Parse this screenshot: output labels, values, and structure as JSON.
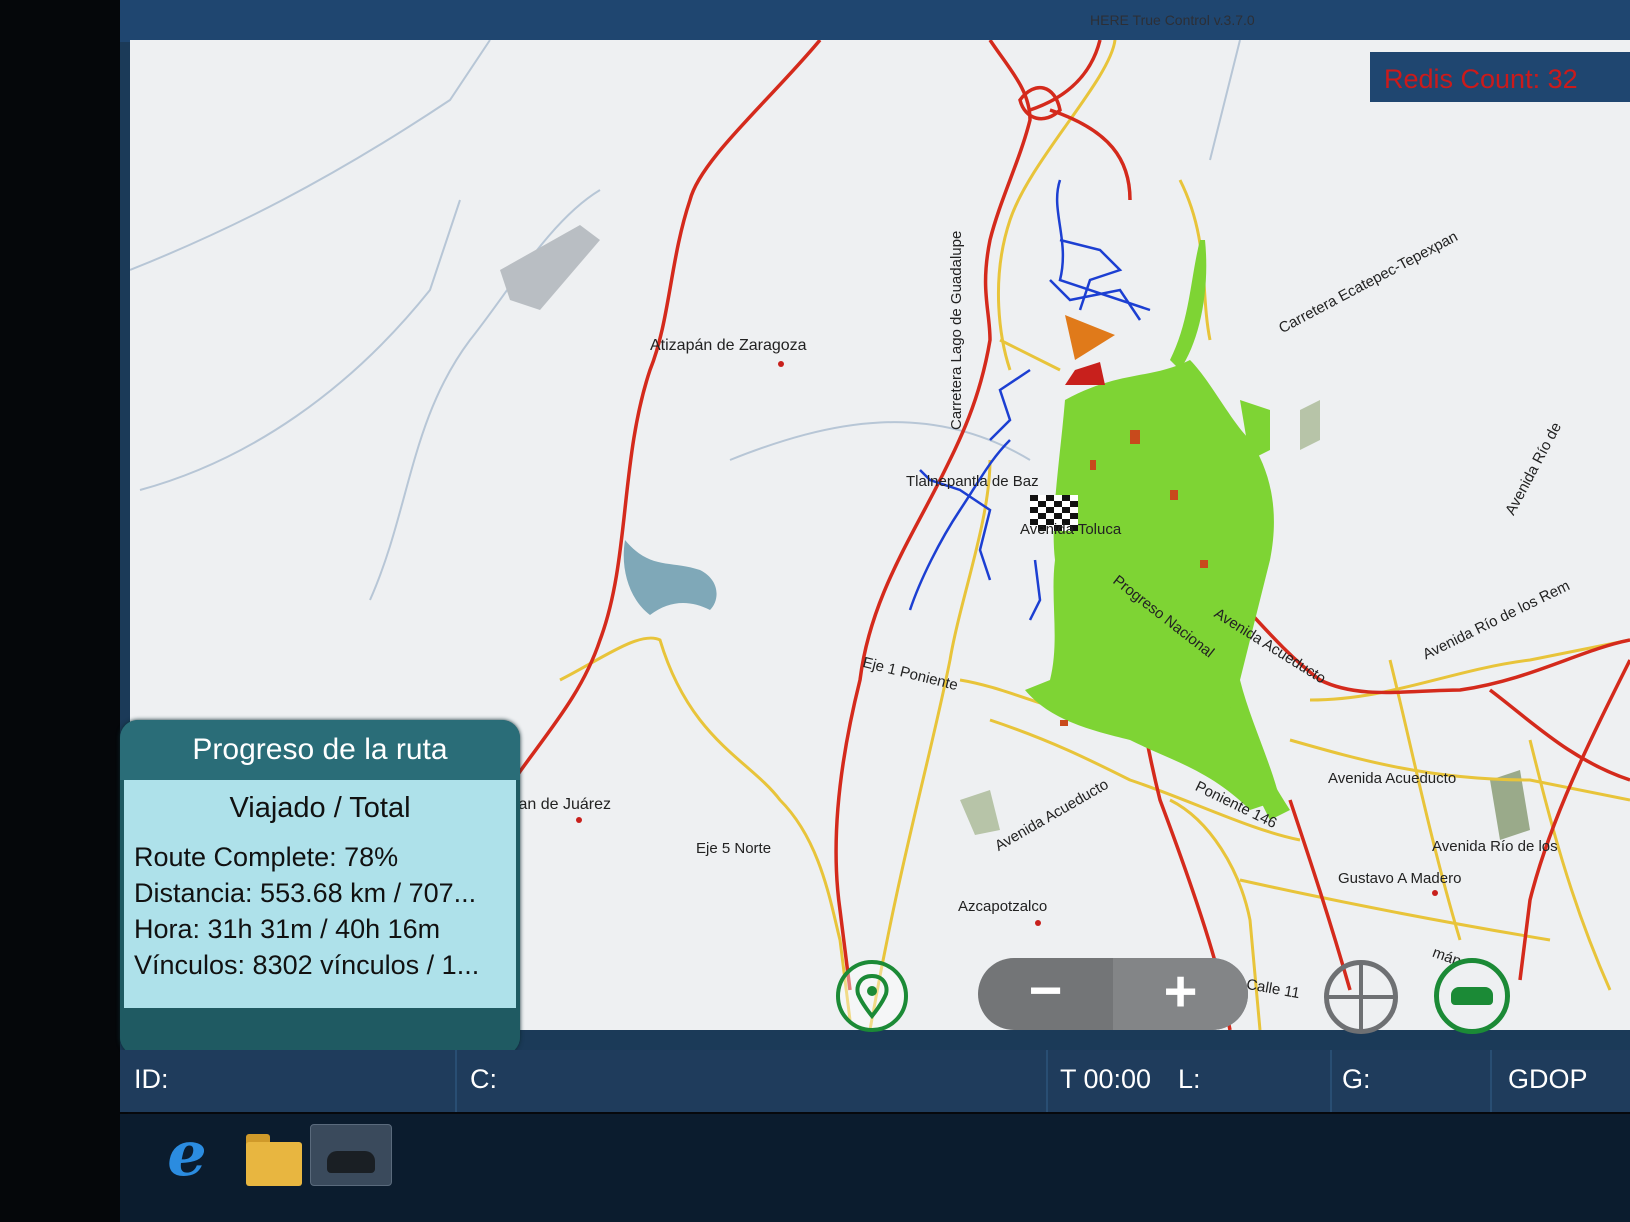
{
  "window": {
    "title": "HERE True Control v.3.7.0"
  },
  "overlay": {
    "redis_label": "Redis Count: 32"
  },
  "map": {
    "labels": {
      "atizapan": "Atizapán de Zaragoza",
      "carretera_lago": "Carretera Lago de Guadalupe",
      "tlalnepantla": "Tlalnepantla de Baz",
      "av_toluca": "Avenida Toluca",
      "carretera_ecatepec": "Carretera Ecatepec-Tepexpan",
      "progreso_nacional": "Progreso Nacional",
      "av_acueducto_1": "Avenida Acueducto",
      "eje1": "Eje 1 Poniente",
      "av_rio_rem": "Avenida Río de los Rem",
      "av_rio_right": "Avenida Río de",
      "nicolas": "lpan de Juárez",
      "eje5": "Eje 5 Norte",
      "av_acueducto_2": "Avenida Acueducto",
      "poniente146": "Poniente 146",
      "av_acueducto_3": "Avenida Acueducto",
      "av_rio_los": "Avenida Río de los",
      "gustavo": "Gustavo A Madero",
      "azcapotzalco": "Azcapotzalco",
      "calle11": "Calle 11",
      "man": "mán"
    }
  },
  "route_progress": {
    "title": "Progreso de la ruta",
    "subtitle": "Viajado / Total",
    "complete": "Route Complete: 78%",
    "distance": "Distancia: 553.68 km / 707...",
    "time": "Hora: 31h 31m / 40h 16m",
    "links": "Vínculos: 8302 vínculos / 1..."
  },
  "controls": {
    "zoom_out": "−",
    "zoom_in": "+",
    "icons": [
      "location-pin-icon",
      "crosshair-icon",
      "car-follow-icon"
    ]
  },
  "status_bar": {
    "id": "ID:",
    "c": "C:",
    "t": "T 00:00",
    "l": "L:",
    "g": "G:",
    "gdop": "GDOP"
  },
  "taskbar": {
    "ie_glyph": "e",
    "icons": [
      "internet-explorer-icon",
      "file-explorer-icon",
      "car-app-icon"
    ]
  }
}
